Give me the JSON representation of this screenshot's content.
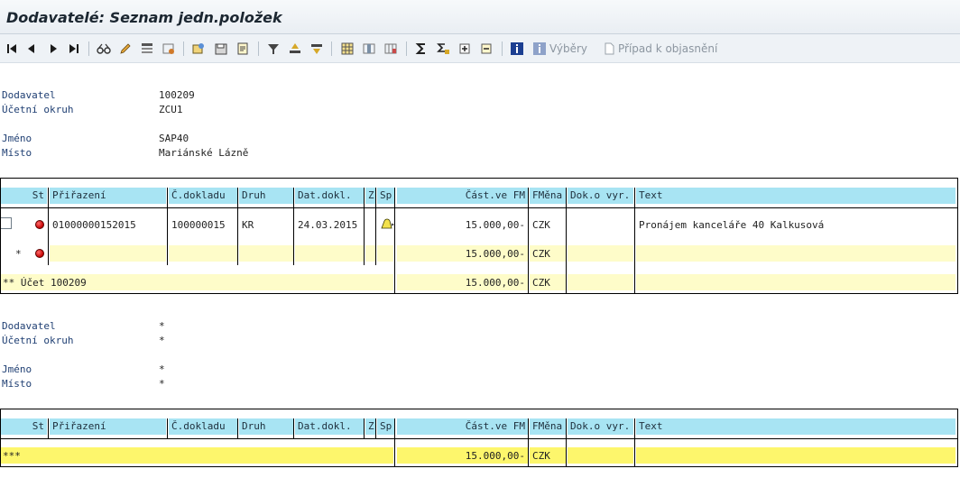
{
  "window": {
    "title": "Dodavatelé: Seznam jedn.položek"
  },
  "toolbar": {
    "icons": [
      "first-page-icon",
      "previous-page-icon",
      "next-page-icon",
      "last-page-icon",
      "glasses-icon",
      "pencil-icon",
      "layout-icon",
      "change-layout-icon",
      "choose-detail-icon",
      "save-icon",
      "document-icon",
      "filter-icon",
      "sort-ascending-icon",
      "sort-descending-icon",
      "grid-icon",
      "column-icon",
      "columns-icon",
      "sum-icon",
      "subtotal-icon",
      "expand-icon",
      "collapse-icon",
      "info-icon"
    ],
    "selections_label": "Výběry",
    "dispute_case_label": "Případ k objasnění"
  },
  "block1": {
    "vendor_label": "Dodavatel",
    "vendor_value": "100209",
    "company_code_label": "Účetní okruh",
    "company_code_value": "ZCU1",
    "name_label": "Jméno",
    "name_value": "SAP40",
    "city_label": "Místo",
    "city_value": "Mariánské Lázně"
  },
  "columns": {
    "st": "St",
    "assignment": "Přiřazení",
    "doc_no": "Č.dokladu",
    "type": "Druh",
    "doc_date": "Dat.dokl.",
    "z": "Z",
    "sp": "Sp",
    "amount": "Část.ve FM",
    "currency": "FMěna",
    "clearing_doc": "Dok.o vyr.",
    "text": "Text"
  },
  "table1": {
    "row": {
      "assignment": "01000000152015",
      "doc_no": "100000015",
      "type": "KR",
      "doc_date": "24.03.2015",
      "amount": "15.000,00-",
      "currency": "CZK",
      "clearing_doc": "",
      "text": "Pronájem kanceláře 40 Kalkusová"
    },
    "subtotal": {
      "marker": "*",
      "amount": "15.000,00-",
      "currency": "CZK"
    },
    "account_total": {
      "label": "** Účet 100209",
      "amount": "15.000,00-",
      "currency": "CZK"
    }
  },
  "block2": {
    "vendor_label": "Dodavatel",
    "vendor_value": "*",
    "company_code_label": "Účetní okruh",
    "company_code_value": "*",
    "name_label": "Jméno",
    "name_value": "*",
    "city_label": "Místo",
    "city_value": "*"
  },
  "table2": {
    "grand_total": {
      "label": "***",
      "amount": "15.000,00-",
      "currency": "CZK"
    }
  },
  "colors": {
    "header_cyan": "#a8e4f3",
    "total_yellow_light": "#fefcc9",
    "total_yellow_dark": "#fdf66c",
    "label_blue": "#1f3f73"
  }
}
